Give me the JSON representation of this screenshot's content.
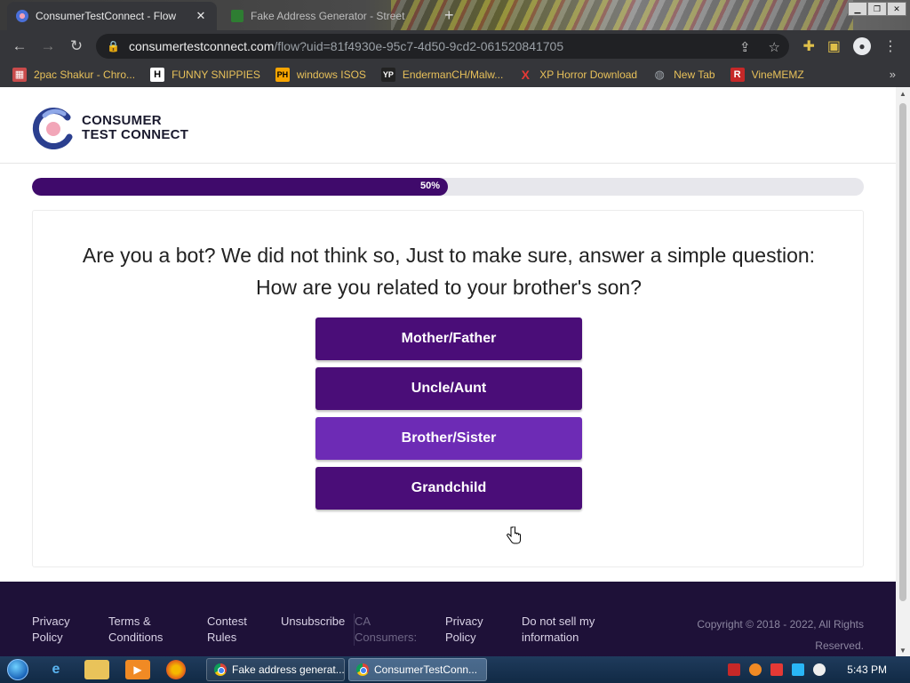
{
  "browser": {
    "tabs": [
      {
        "title": "ConsumerTestConnect - Flow",
        "active": true
      },
      {
        "title": "Fake Address Generator - Street",
        "active": false
      }
    ],
    "address": {
      "host": "consumertestconnect.com",
      "path": "/flow?uid=81f4930e-95c7-4d50-9cd2-061520841705"
    },
    "bookmarks": [
      {
        "label": "2pac Shakur - Chro...",
        "icon": "calendar-icon"
      },
      {
        "label": "FUNNY SNIPPIES",
        "icon": "H"
      },
      {
        "label": "windows ISOS",
        "icon": "PH"
      },
      {
        "label": "EndermanCH/Malw...",
        "icon": "YP"
      },
      {
        "label": "XP Horror Download",
        "icon": "X"
      },
      {
        "label": "New Tab",
        "icon": "globe-icon"
      },
      {
        "label": "VineMEMZ",
        "icon": "R"
      }
    ],
    "more_bookmarks": "»"
  },
  "site": {
    "logo": {
      "line1": "CONSUMER",
      "line2": "TEST CONNECT"
    },
    "progress": {
      "percent": 50,
      "label": "50%"
    },
    "question": "Are you a bot? We did not think so, Just to make sure, answer a simple question: How are you related to your brother's son?",
    "answers": [
      "Mother/Father",
      "Uncle/Aunt",
      "Brother/Sister",
      "Grandchild"
    ],
    "hovered_answer_index": 2,
    "footer": {
      "links": [
        "Privacy Policy",
        "Terms & Conditions",
        "Contest Rules",
        "Unsubscribe"
      ],
      "ca_label": "CA Consumers:",
      "ca_links": [
        "Privacy Policy",
        "Do not sell my information"
      ],
      "copyright": "Copyright © 2018 - 2022, All Rights Reserved."
    }
  },
  "taskbar": {
    "tasks": [
      {
        "title": "Fake address generat...",
        "active": false
      },
      {
        "title": "ConsumerTestConn...",
        "active": true
      }
    ],
    "clock": "5:43 PM"
  },
  "colors": {
    "brand_purple": "#4a0d78",
    "brand_purple_hover": "#6d2bb5",
    "progress_fill": "#3f0a6b",
    "footer_bg": "#1e1138",
    "bookmark_text": "#e8c15a"
  }
}
